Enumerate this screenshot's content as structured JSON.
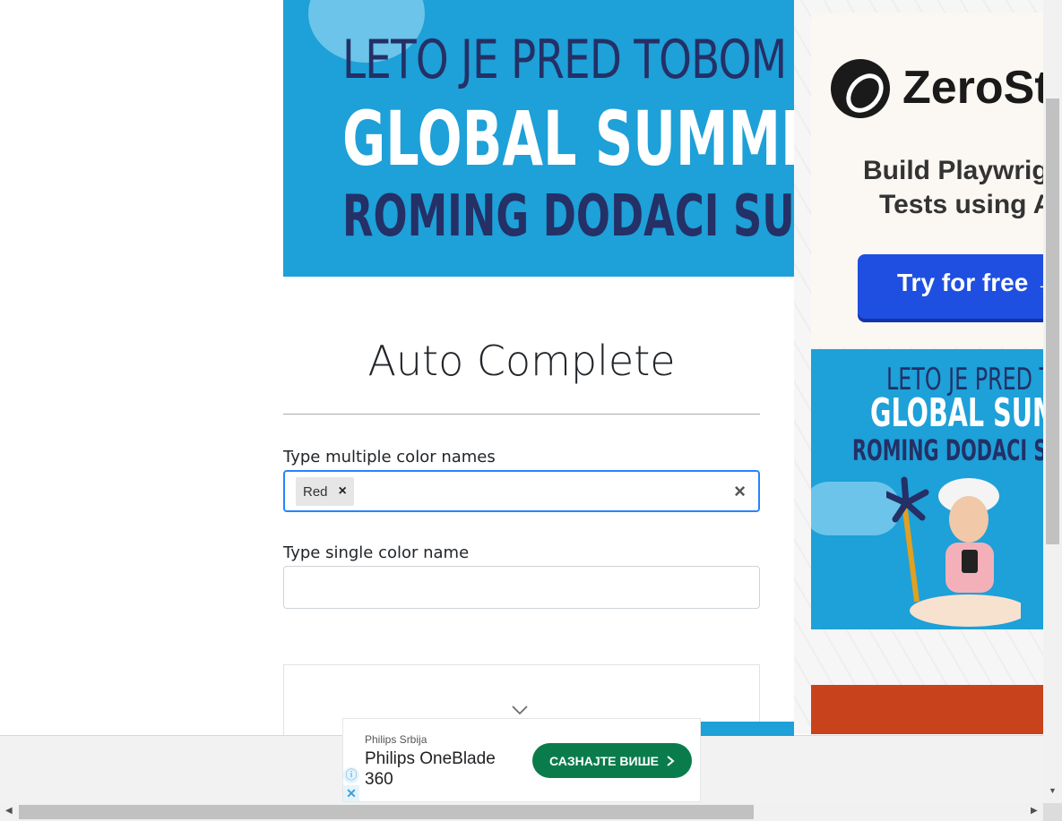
{
  "banner": {
    "line1": "LETO JE PRED TOBOM",
    "line2": "GLOBAL SUMMER",
    "line3": "ROMING DODACI SU UZ"
  },
  "page": {
    "title": "Auto Complete"
  },
  "form": {
    "multi_label": "Type multiple color names",
    "multi_chips": [
      {
        "label": "Red"
      }
    ],
    "chip_remove_glyph": "×",
    "clear_glyph": "×",
    "single_label": "Type single color name",
    "single_value": ""
  },
  "sidebar": {
    "zs_ad": {
      "brand": "ZeroStep",
      "text_line1": "Build Playwright",
      "text_line2": "Tests using AI",
      "button": "Try for free →"
    },
    "banner": {
      "line1": "LETO JE PRED TOBOM",
      "line2": "GLOBAL SUMMER",
      "line3": "ROMING DODACI SU UZ"
    }
  },
  "bottom_ad": {
    "advertiser": "Philips Srbija",
    "product": "Philips OneBlade 360",
    "cta": "САЗНАЈТЕ ВИШЕ",
    "cta_icon": "chevron-right-icon",
    "info_icon": "info-icon",
    "close_icon": "close-icon"
  },
  "colors": {
    "banner_blue": "#1ea0d8",
    "navy": "#243066",
    "focus_border": "#2684ff",
    "cta_green": "#0a7c4c",
    "zs_button": "#1f4fe0"
  }
}
